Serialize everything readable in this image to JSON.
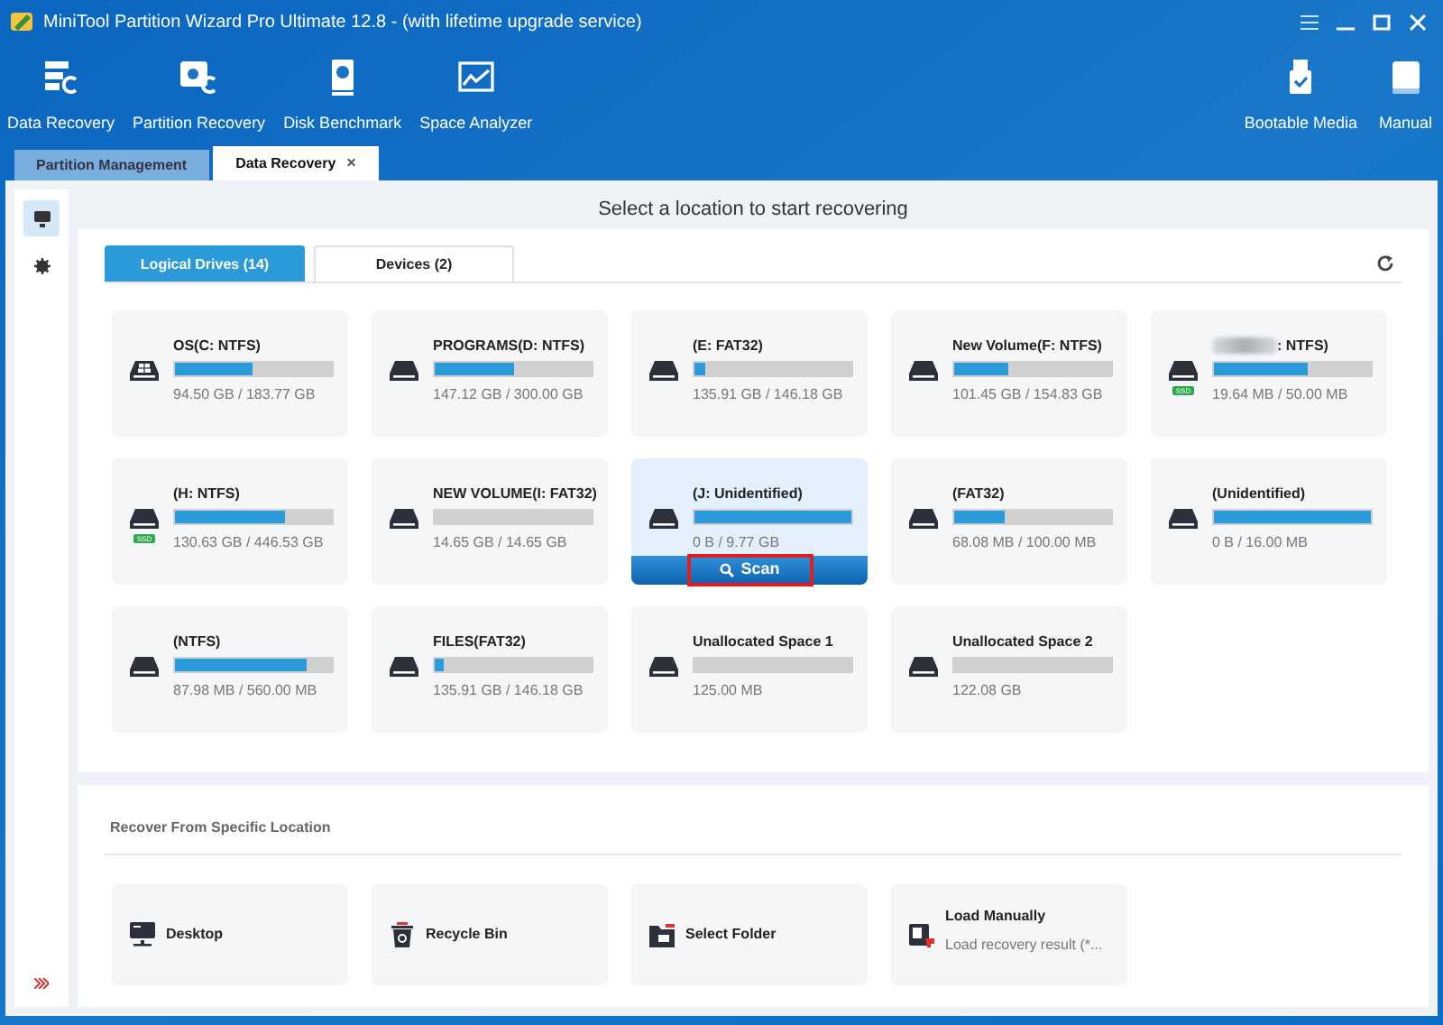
{
  "window": {
    "title": "MiniTool Partition Wizard Pro Ultimate 12.8 - (with lifetime upgrade service)"
  },
  "toolbar": [
    {
      "label": "Data Recovery",
      "kind": "datarec"
    },
    {
      "label": "Partition Recovery",
      "kind": "partrec"
    },
    {
      "label": "Disk Benchmark",
      "kind": "bench"
    },
    {
      "label": "Space Analyzer",
      "kind": "analyzer"
    }
  ],
  "toolbar_right": [
    {
      "label": "Bootable Media",
      "kind": "usb"
    },
    {
      "label": "Manual",
      "kind": "book"
    }
  ],
  "tabs": [
    {
      "label": "Partition Management",
      "selected": false
    },
    {
      "label": "Data Recovery",
      "selected": true,
      "close": "×"
    }
  ],
  "sidebar": [
    {
      "kind": "monitor",
      "selected": true
    },
    {
      "kind": "gear",
      "selected": false
    }
  ],
  "heading": "Select a location to start recovering",
  "drive_tabs": [
    {
      "label": "Logical Drives (14)",
      "selected": true
    },
    {
      "label": "Devices (2)",
      "selected": false
    }
  ],
  "scan_label": "Scan",
  "drives": [
    {
      "label": "OS(C: NTFS)",
      "size": "94.50 GB / 183.77 GB",
      "level": 0.49,
      "kind": "system",
      "redacted": false,
      "selected": false
    },
    {
      "label": "PROGRAMS(D: NTFS)",
      "size": "147.12 GB / 300.00 GB",
      "level": 0.51,
      "kind": "disk",
      "redacted": false,
      "selected": false
    },
    {
      "label": "(E: FAT32)",
      "size": "135.91 GB / 146.18 GB",
      "level": 0.07,
      "kind": "disk",
      "redacted": false,
      "selected": false
    },
    {
      "label": "New Volume(F: NTFS)",
      "size": "101.45 GB / 154.83 GB",
      "level": 0.34,
      "kind": "disk",
      "redacted": false,
      "selected": false
    },
    {
      "label": ": NTFS)",
      "size": "19.64 MB / 50.00 MB",
      "level": 0.6,
      "kind": "disk",
      "ssd_badge": "SSD",
      "redacted": true,
      "selected": false
    },
    {
      "label": "(H: NTFS)",
      "size": "130.63 GB / 446.53 GB",
      "level": 0.7,
      "kind": "disk",
      "ssd_badge": "SSD",
      "redacted": false,
      "selected": false
    },
    {
      "label": "NEW VOLUME(I: FAT32)",
      "size": "14.65 GB / 14.65 GB",
      "level": 0,
      "kind": "disk",
      "redacted": false,
      "selected": false
    },
    {
      "label": "(J: Unidentified)",
      "size": "0 B / 9.77 GB",
      "level": 1,
      "kind": "disk",
      "redacted": false,
      "selected": true
    },
    {
      "label": "(FAT32)",
      "size": "68.08 MB / 100.00 MB",
      "level": 0.32,
      "kind": "disk",
      "redacted": false,
      "selected": false
    },
    {
      "label": "(Unidentified)",
      "size": "0 B / 16.00 MB",
      "level": 1,
      "kind": "disk",
      "redacted": false,
      "selected": false
    },
    {
      "label": "(NTFS)",
      "size": "87.98 MB / 560.00 MB",
      "level": 0.84,
      "kind": "disk",
      "redacted": false,
      "selected": false
    },
    {
      "label": "FILES(FAT32)",
      "size": "135.91 GB / 146.18 GB",
      "level": 0.06,
      "kind": "disk",
      "redacted": false,
      "selected": false
    },
    {
      "label": "Unallocated Space 1",
      "size": "125.00 MB",
      "level": 0,
      "kind": "disk",
      "redacted": false,
      "selected": false
    },
    {
      "label": "Unallocated Space 2",
      "size": "122.08 GB",
      "level": 0,
      "kind": "disk",
      "redacted": false,
      "selected": false
    }
  ],
  "specific": {
    "title": "Recover From Specific Location",
    "items": [
      {
        "label": "Desktop",
        "kind": "desktop"
      },
      {
        "label": "Recycle Bin",
        "kind": "bin"
      },
      {
        "label": "Select Folder",
        "kind": "folder"
      },
      {
        "label": "Load Manually",
        "kind": "load",
        "sub": "Load recovery result (*..."
      }
    ]
  }
}
